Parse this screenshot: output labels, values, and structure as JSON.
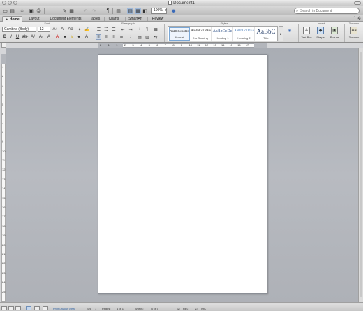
{
  "window": {
    "title": "Document1"
  },
  "toolbar": {
    "zoom": "100%",
    "search_placeholder": "Search in Document",
    "icons": [
      "new-icon",
      "open-icon",
      "save-icon",
      "print-icon",
      "undo-icon",
      "redo-icon",
      "pilcrow-icon",
      "sidebar-icon",
      "gallery-icon",
      "toolbox-icon",
      "help-icon"
    ]
  },
  "ribbon_tabs": [
    "Home",
    "Layout",
    "Document Elements",
    "Tables",
    "Charts",
    "SmartArt",
    "Review"
  ],
  "ribbon": {
    "groups": {
      "font": "Font",
      "paragraph": "Paragraph",
      "styles": "Styles",
      "insert": "Insert",
      "themes": "Themes"
    },
    "font_name": "Cambria (Body)",
    "font_size": "12",
    "styles": [
      {
        "sample": "AaBbCcDdEe",
        "name": "Normal"
      },
      {
        "sample": "AaBbCcDdEe",
        "name": "No Spacing"
      },
      {
        "sample": "AaBbCcDc",
        "name": "Heading 1"
      },
      {
        "sample": "AaBbCcDdEe",
        "name": "Heading 2"
      },
      {
        "sample": "AaBbC",
        "name": "Title"
      }
    ],
    "insert_buttons": [
      {
        "label": "Text Box",
        "icon": "textbox-icon"
      },
      {
        "label": "Shape",
        "icon": "shape-icon"
      },
      {
        "label": "Picture",
        "icon": "picture-icon"
      }
    ],
    "themes_label": "Themes"
  },
  "ruler": {
    "h_numbers": [
      "2",
      "1",
      "1",
      "2",
      "3",
      "4",
      "5",
      "6",
      "7",
      "8",
      "9",
      "10",
      "11",
      "12",
      "13",
      "14",
      "15",
      "16",
      "17"
    ],
    "v_numbers": [
      "1",
      "2",
      "3",
      "4",
      "5",
      "6",
      "7",
      "8",
      "9",
      "10",
      "11",
      "12",
      "13",
      "14",
      "15",
      "16",
      "17",
      "18",
      "19",
      "20",
      "21",
      "22",
      "23",
      "24",
      "25"
    ]
  },
  "status": {
    "view_name": "Print Layout View",
    "sec_label": "Sec",
    "sec_value": "1",
    "pages_label": "Pages:",
    "pages_value": "1 of 1",
    "words_label": "Words:",
    "words_value": "0 of 0",
    "trk": "TRK",
    "spell": "REC"
  }
}
